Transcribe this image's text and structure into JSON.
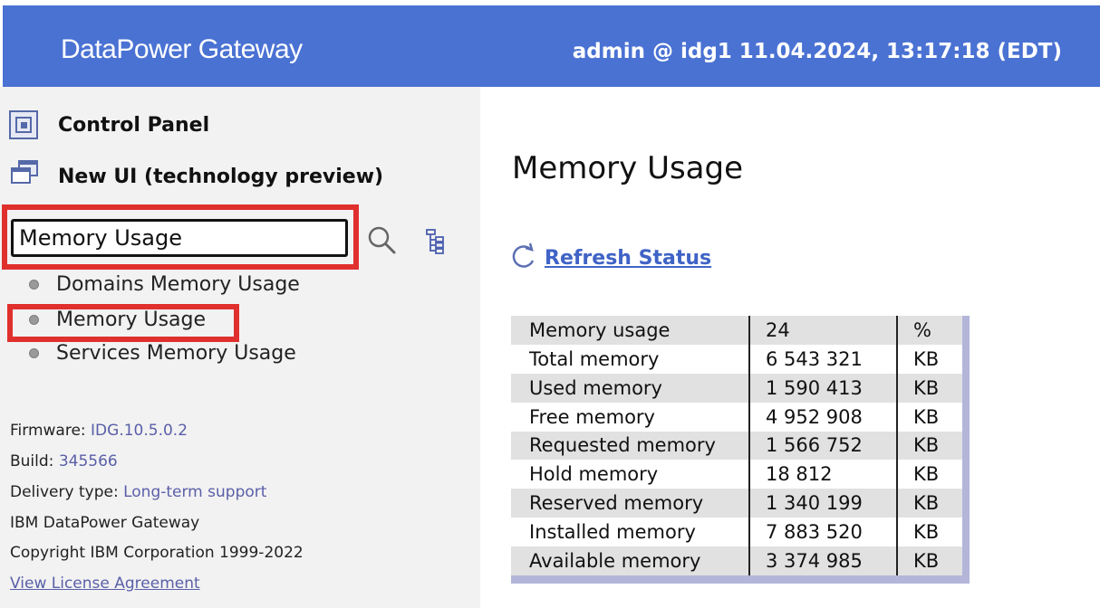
{
  "header": {
    "brand": "DataPower Gateway",
    "session": "admin @ idg1 11.04.2024, 13:17:18 (EDT)",
    "bg_color": "#4a72d3"
  },
  "sidebar": {
    "control_panel": {
      "label": "Control Panel",
      "icon": "control-panel-icon"
    },
    "new_ui": {
      "label": "New UI (technology preview)",
      "icon": "windows-icon"
    },
    "search": {
      "value": "Memory Usage",
      "search_icon": "search-icon",
      "tree_icon": "tree-view-icon"
    },
    "results": [
      {
        "label": "Domains Memory Usage"
      },
      {
        "label": "Memory Usage"
      },
      {
        "label": "Services Memory Usage"
      }
    ],
    "info": {
      "firmware_label": "Firmware:",
      "firmware_value": "IDG.10.5.0.2",
      "build_label": "Build:",
      "build_value": "345566",
      "delivery_label": "Delivery type:",
      "delivery_value": "Long-term support",
      "product": "IBM DataPower Gateway",
      "copyright": "Copyright IBM Corporation 1999-2022",
      "license_link": "View License Agreement"
    }
  },
  "main": {
    "title": "Memory Usage",
    "refresh_label": "Refresh Status",
    "table": {
      "rows": [
        {
          "name": "Memory usage",
          "value": "24",
          "unit": "%"
        },
        {
          "name": "Total memory",
          "value": "6 543 321",
          "unit": "KB"
        },
        {
          "name": "Used memory",
          "value": "1 590 413",
          "unit": "KB"
        },
        {
          "name": "Free memory",
          "value": "4 952 908",
          "unit": "KB"
        },
        {
          "name": "Requested memory",
          "value": "1 566 752",
          "unit": "KB"
        },
        {
          "name": "Hold memory",
          "value": "18 812",
          "unit": "KB"
        },
        {
          "name": "Reserved memory",
          "value": "1 340 199",
          "unit": "KB"
        },
        {
          "name": "Installed memory",
          "value": "7 883 520",
          "unit": "KB"
        },
        {
          "name": "Available memory",
          "value": "3 374 985",
          "unit": "KB"
        }
      ]
    }
  },
  "colors": {
    "highlight": "#e0302e",
    "link": "#3f63c6",
    "info_value": "#5a5fa8"
  }
}
